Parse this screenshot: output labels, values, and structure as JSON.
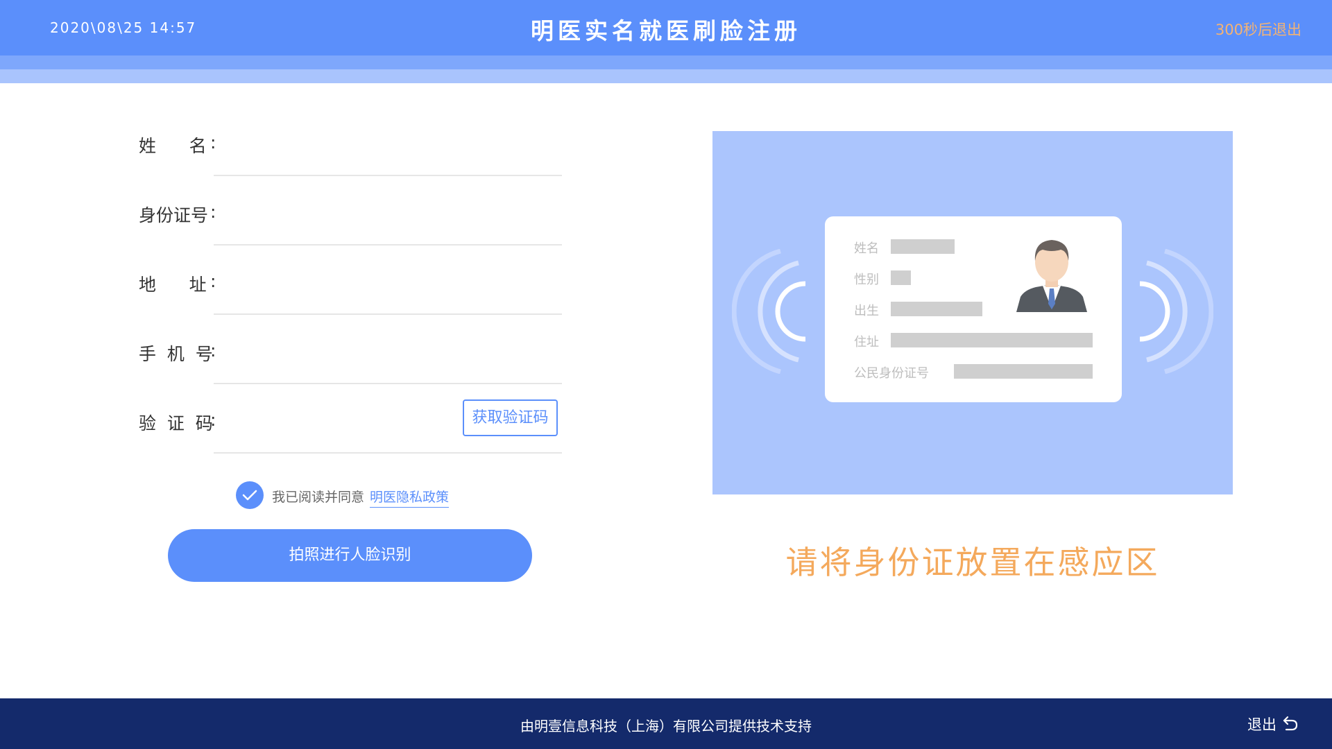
{
  "header": {
    "datetime": "2020\\08\\25   14:57",
    "title": "明医实名就医刷脸注册",
    "timer": "300秒后退出"
  },
  "form": {
    "fields": [
      {
        "label": "姓      名",
        "value": ""
      },
      {
        "label": "身份证号",
        "value": ""
      },
      {
        "label": "地      址",
        "value": ""
      },
      {
        "label": "手  机  号",
        "value": ""
      },
      {
        "label": "验  证  码",
        "value": ""
      }
    ],
    "colon": ":",
    "get_code_label": "获取验证码",
    "agree_text": "我已阅读并同意",
    "agree_link": "明医隐私政策",
    "agree_checked": true,
    "submit_label": "拍照进行人脸识别"
  },
  "card": {
    "fields": [
      "姓名",
      "性别",
      "出生",
      "住址",
      "公民身份证号"
    ]
  },
  "hint": "请将身份证放置在感应区",
  "footer": {
    "credit": "由明壹信息科技（上海）有限公司提供技术支持",
    "exit_label": "退出"
  },
  "colors": {
    "primary": "#5b8ffb",
    "accent": "#f4a95c",
    "footer_bg": "#142a6b",
    "panel_bg": "#abc5fd"
  },
  "icons": [
    "check-icon",
    "person-avatar-icon",
    "nfc-wave-left-icon",
    "nfc-wave-right-icon",
    "exit-return-icon"
  ]
}
